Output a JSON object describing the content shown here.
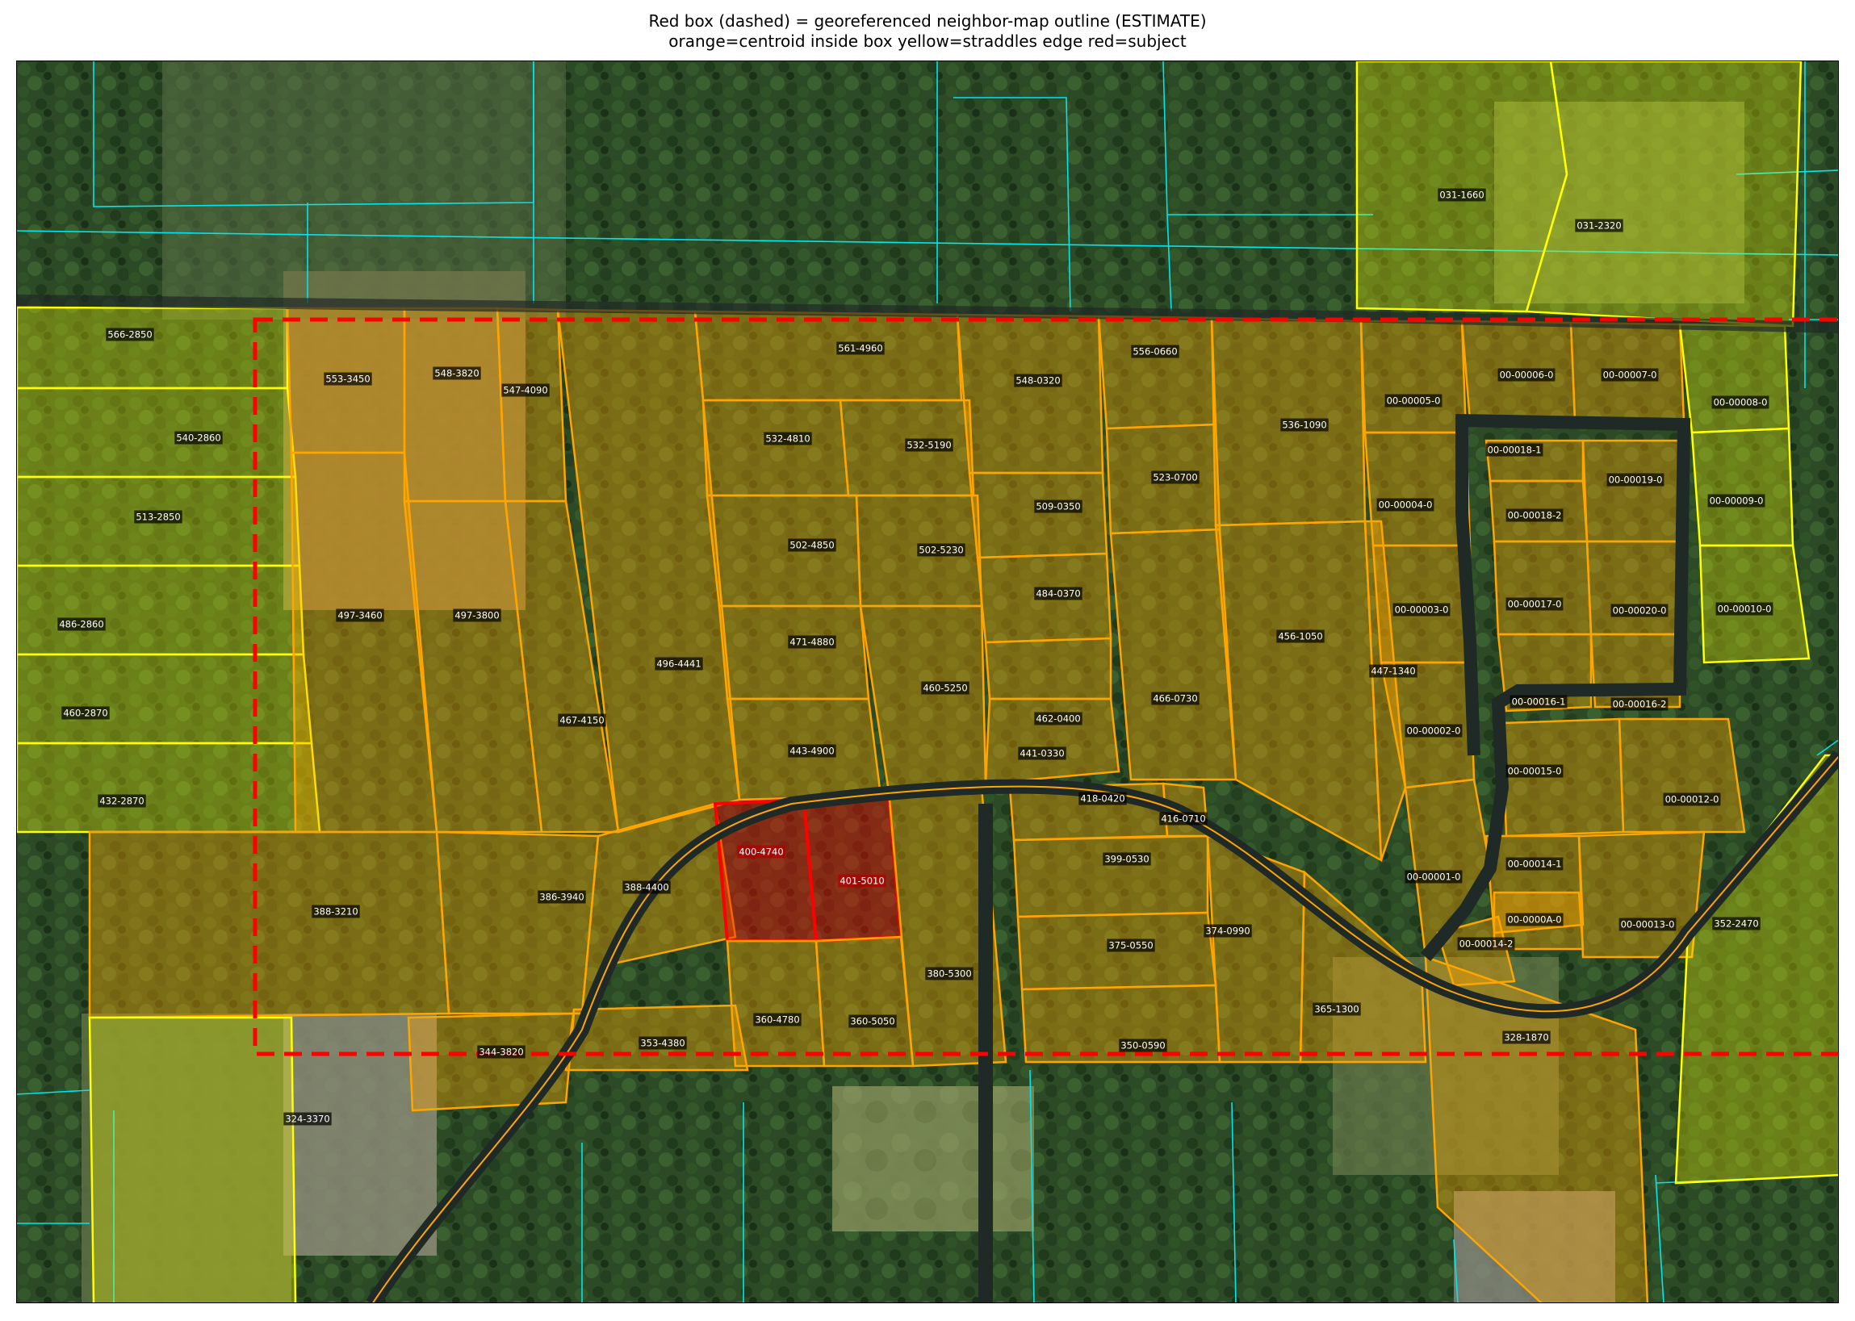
{
  "title_line1": "Red box (dashed) = georeferenced neighbor-map outline (ESTIMATE)",
  "title_line2": "orange=centroid inside box  yellow=straddles edge  red=subject",
  "colors": {
    "inside": "#ffa500",
    "edge": "#ffff00",
    "subject": "#ff0000",
    "outside": "#00e5ee",
    "outline_box": "#ff0000",
    "label_bg": "#000000",
    "label_text": "#ffffff"
  },
  "parcels": [
    {
      "id": "566-2850",
      "cls": "edge"
    },
    {
      "id": "540-2860",
      "cls": "edge"
    },
    {
      "id": "513-2850",
      "cls": "edge"
    },
    {
      "id": "486-2860",
      "cls": "edge"
    },
    {
      "id": "460-2870",
      "cls": "edge"
    },
    {
      "id": "432-2870",
      "cls": "edge"
    },
    {
      "id": "553-3450",
      "cls": "inside"
    },
    {
      "id": "548-3820",
      "cls": "inside"
    },
    {
      "id": "547-4090",
      "cls": "inside"
    },
    {
      "id": "497-3460",
      "cls": "inside"
    },
    {
      "id": "497-3800",
      "cls": "inside"
    },
    {
      "id": "467-4150",
      "cls": "inside"
    },
    {
      "id": "496-4441",
      "cls": "inside"
    },
    {
      "id": "561-4960",
      "cls": "inside"
    },
    {
      "id": "532-4810",
      "cls": "inside"
    },
    {
      "id": "532-5190",
      "cls": "inside"
    },
    {
      "id": "502-4850",
      "cls": "inside"
    },
    {
      "id": "502-5230",
      "cls": "inside"
    },
    {
      "id": "471-4880",
      "cls": "inside"
    },
    {
      "id": "460-5250",
      "cls": "inside"
    },
    {
      "id": "443-4900",
      "cls": "inside"
    },
    {
      "id": "548-0320",
      "cls": "inside"
    },
    {
      "id": "509-0350",
      "cls": "inside"
    },
    {
      "id": "484-0370",
      "cls": "inside"
    },
    {
      "id": "462-0400",
      "cls": "inside"
    },
    {
      "id": "441-0330",
      "cls": "inside"
    },
    {
      "id": "556-0660",
      "cls": "inside"
    },
    {
      "id": "523-0700",
      "cls": "inside"
    },
    {
      "id": "466-0730",
      "cls": "inside"
    },
    {
      "id": "536-1090",
      "cls": "inside"
    },
    {
      "id": "456-1050",
      "cls": "inside"
    },
    {
      "id": "447-1340",
      "cls": "inside"
    },
    {
      "id": "00-00005-0",
      "cls": "inside"
    },
    {
      "id": "00-00004-0",
      "cls": "inside"
    },
    {
      "id": "00-00003-0",
      "cls": "inside"
    },
    {
      "id": "00-00002-0",
      "cls": "inside"
    },
    {
      "id": "00-00001-0",
      "cls": "inside"
    },
    {
      "id": "00-00006-0",
      "cls": "inside"
    },
    {
      "id": "00-00007-0",
      "cls": "inside"
    },
    {
      "id": "00-00008-0",
      "cls": "edge"
    },
    {
      "id": "00-00018-1",
      "cls": "inside"
    },
    {
      "id": "00-00019-0",
      "cls": "inside"
    },
    {
      "id": "00-00018-2",
      "cls": "inside"
    },
    {
      "id": "00-00009-0",
      "cls": "edge"
    },
    {
      "id": "00-00017-0",
      "cls": "inside"
    },
    {
      "id": "00-00020-0",
      "cls": "inside"
    },
    {
      "id": "00-00010-0",
      "cls": "edge"
    },
    {
      "id": "00-00016-1",
      "cls": "inside"
    },
    {
      "id": "00-00016-2",
      "cls": "inside"
    },
    {
      "id": "00-00015-0",
      "cls": "inside"
    },
    {
      "id": "00-00012-0",
      "cls": "inside"
    },
    {
      "id": "00-00014-1",
      "cls": "inside"
    },
    {
      "id": "00-0000A-0",
      "cls": "inside"
    },
    {
      "id": "00-00013-0",
      "cls": "inside"
    },
    {
      "id": "00-00014-2",
      "cls": "inside"
    },
    {
      "id": "031-1660",
      "cls": "edge"
    },
    {
      "id": "031-2320",
      "cls": "edge"
    },
    {
      "id": "352-2470",
      "cls": "edge"
    },
    {
      "id": "388-3210",
      "cls": "inside"
    },
    {
      "id": "386-3940",
      "cls": "inside"
    },
    {
      "id": "388-4400",
      "cls": "inside"
    },
    {
      "id": "400-4740",
      "cls": "subject"
    },
    {
      "id": "401-5010",
      "cls": "subject"
    },
    {
      "id": "380-5300",
      "cls": "inside"
    },
    {
      "id": "418-0420",
      "cls": "inside"
    },
    {
      "id": "416-0710",
      "cls": "inside"
    },
    {
      "id": "399-0530",
      "cls": "inside"
    },
    {
      "id": "375-0550",
      "cls": "inside"
    },
    {
      "id": "374-0990",
      "cls": "inside"
    },
    {
      "id": "365-1300",
      "cls": "inside"
    },
    {
      "id": "350-0590",
      "cls": "inside"
    },
    {
      "id": "328-1870",
      "cls": "inside"
    },
    {
      "id": "360-4780",
      "cls": "inside"
    },
    {
      "id": "360-5050",
      "cls": "inside"
    },
    {
      "id": "353-4380",
      "cls": "inside"
    },
    {
      "id": "344-3820",
      "cls": "inside"
    },
    {
      "id": "324-3370",
      "cls": "edge"
    }
  ]
}
